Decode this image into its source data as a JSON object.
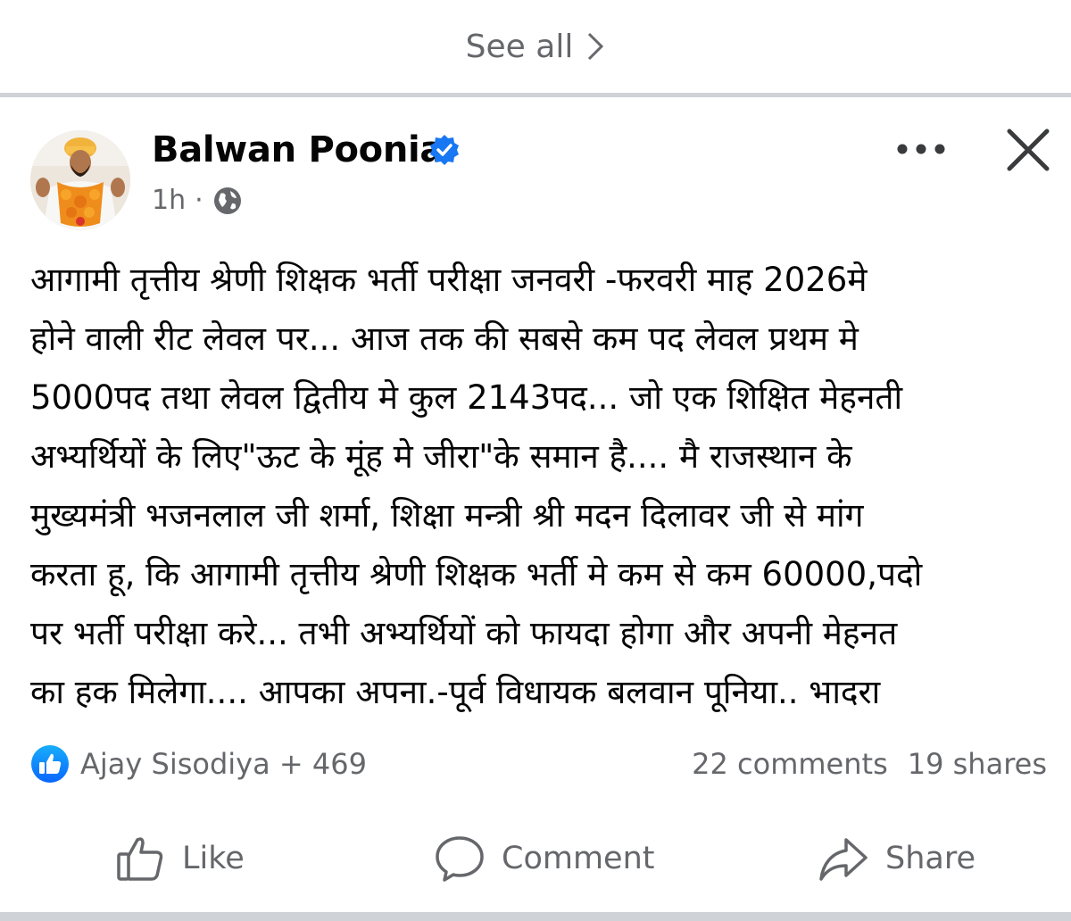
{
  "see_all": {
    "label": "See all"
  },
  "post": {
    "author": "Balwan Poonia",
    "time": "1h",
    "separator": "·",
    "text": "आगामी तृत्तीय श्रेणी शिक्षक भर्ती परीक्षा जनवरी -फरवरी माह 2026मे\nहोने वाली रीट लेवल पर... आज तक की सबसे कम पद लेवल प्रथम मे\n5000पद तथा लेवल द्वितीय मे कुल 2143पद... जो एक शिक्षित मेहनती\nअभ्यर्थियों के लिए\"ऊट के मूंह मे जीरा\"के समान है.... मै राजस्थान के\nमुख्यमंत्री भजनलाल जी शर्मा, शिक्षा मन्त्री श्री मदन दिलावर जी से मांग\nकरता हू, कि आगामी तृत्तीय श्रेणी शिक्षक भर्ती मे कम से कम 60000,पदो\nपर भर्ती परीक्षा करे... तभी अभ्यर्थियों को फायदा होगा और अपनी मेहनत\nका हक मिलेगा....  आपका अपना.-पूर्व विधायक बलवान पूनिया.. भादरा",
    "reactions": "Ajay Sisodiya + 469",
    "comments": "22 comments",
    "shares": "19 shares"
  },
  "actions": {
    "like": "Like",
    "comment": "Comment",
    "share": "Share"
  },
  "colors": {
    "secondary_text": "#65676b",
    "primary_text": "#050505",
    "brand_blue": "#1877f2",
    "divider": "#cfd2d6"
  }
}
